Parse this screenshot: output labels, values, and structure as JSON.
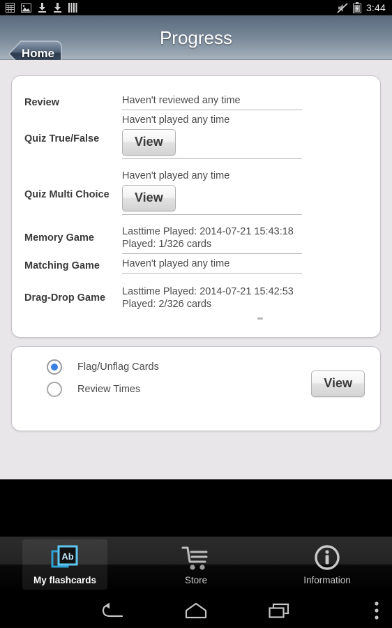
{
  "statusbar": {
    "clock": "3:44",
    "left_icons": [
      "calendar-icon",
      "image-icon",
      "download-icon",
      "download-icon",
      "sim-bars-icon"
    ],
    "right_icons": [
      "volume-muted-icon",
      "battery-charging-icon"
    ]
  },
  "titlebar": {
    "title": "Progress",
    "home_label": "Home"
  },
  "progress": {
    "rows": [
      {
        "label": "Review",
        "lines": [
          "Haven't reviewed any time"
        ],
        "button": null
      },
      {
        "label": "Quiz True/False",
        "lines": [
          "Haven't played any time"
        ],
        "button": "View"
      },
      {
        "label": "Quiz Multi Choice",
        "lines": [
          "Haven't played any time"
        ],
        "button": "View"
      },
      {
        "label": "Memory Game",
        "lines": [
          "Lasttime Played: 2014-07-21 15:43:18",
          "Played: 1/326 cards"
        ],
        "button": null
      },
      {
        "label": "Matching Game",
        "lines": [
          "Haven't played any time"
        ],
        "button": null
      },
      {
        "label": "Drag-Drop Game",
        "lines": [
          "Lasttime Played: 2014-07-21 15:42:53",
          "Played: 2/326 cards"
        ],
        "button": null
      }
    ]
  },
  "options": {
    "radios": [
      {
        "label": "Flag/Unflag Cards",
        "selected": true
      },
      {
        "label": "Review Times",
        "selected": false
      }
    ],
    "view_label": "View",
    "accent_color": "#3b7fe0"
  },
  "tabbar": {
    "tabs": [
      {
        "label": "My flashcards",
        "icon": "flashcards-icon",
        "active": true
      },
      {
        "label": "Store",
        "icon": "shopping-cart-icon",
        "active": false
      },
      {
        "label": "Information",
        "icon": "info-circle-icon",
        "active": false
      }
    ]
  },
  "navbar": {
    "buttons": [
      "back-icon",
      "home-icon",
      "recents-icon",
      "overflow-menu-icon"
    ]
  }
}
